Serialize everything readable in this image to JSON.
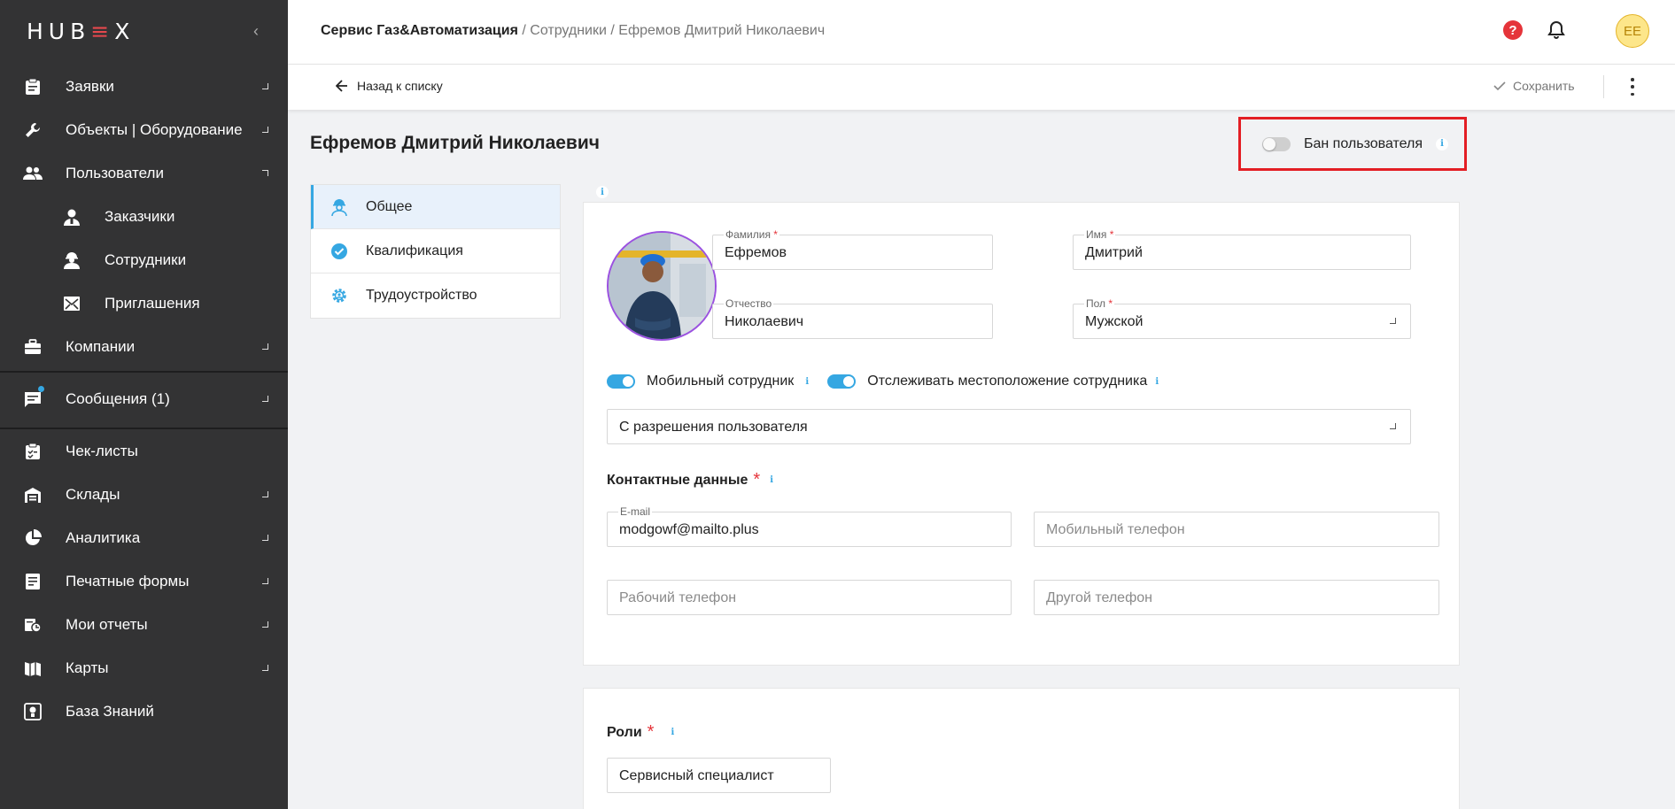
{
  "app": {
    "logo_text_a": "HUB",
    "logo_text_b": "≡",
    "logo_text_c": "X"
  },
  "sidebar": {
    "items": [
      {
        "label": "Заявки",
        "icon": "clipboard-icon",
        "expandable": true
      },
      {
        "label": "Объекты | Оборудование",
        "icon": "wrench-icon",
        "expandable": true
      },
      {
        "label": "Пользователи",
        "icon": "users-icon",
        "expandable": true,
        "expanded": true
      },
      {
        "label": "Заказчики",
        "icon": "customer-icon",
        "sub": true
      },
      {
        "label": "Сотрудники",
        "icon": "worker-icon",
        "sub": true
      },
      {
        "label": "Приглашения",
        "icon": "invite-icon",
        "sub": true
      },
      {
        "label": "Компании",
        "icon": "briefcase-icon",
        "expandable": true
      },
      {
        "label": "Сообщения (1)",
        "icon": "message-icon",
        "expandable": true
      },
      {
        "label": "Чек-листы",
        "icon": "checklist-icon"
      },
      {
        "label": "Склады",
        "icon": "warehouse-icon",
        "expandable": true
      },
      {
        "label": "Аналитика",
        "icon": "pie-chart-icon",
        "expandable": true
      },
      {
        "label": "Печатные формы",
        "icon": "print-form-icon",
        "expandable": true
      },
      {
        "label": "Мои отчеты",
        "icon": "reports-icon",
        "expandable": true
      },
      {
        "label": "Карты",
        "icon": "map-icon",
        "expandable": true
      },
      {
        "label": "База Знаний",
        "icon": "knowledge-icon"
      }
    ]
  },
  "header": {
    "breadcrumb_root": "Сервис Газ&Автоматизация",
    "breadcrumb_sep": " / ",
    "breadcrumb_mid": "Сотрудники",
    "breadcrumb_current": "Ефремов Дмитрий Николаевич",
    "avatar_initials": "EE"
  },
  "toolbar": {
    "back_label": "Назад к списку",
    "save_label": "Сохранить"
  },
  "page": {
    "title": "Ефремов Дмитрий Николаевич",
    "ban_label": "Бан пользователя"
  },
  "tabs": [
    {
      "label": "Общее",
      "active": true
    },
    {
      "label": "Квалификация"
    },
    {
      "label": "Трудоустройство"
    }
  ],
  "form": {
    "last_name": {
      "label": "Фамилия",
      "value": "Ефремов"
    },
    "first_name": {
      "label": "Имя",
      "value": "Дмитрий"
    },
    "patronymic": {
      "label": "Отчество",
      "value": "Николаевич"
    },
    "gender": {
      "label": "Пол",
      "value": "Мужской"
    },
    "mobile_employee_label": "Мобильный сотрудник",
    "track_location_label": "Отслеживать местоположение сотрудника",
    "location_mode": "С разрешения пользователя",
    "contacts_title": "Контактные данные",
    "email": {
      "label": "E-mail",
      "value": "modgowf@mailto.plus"
    },
    "mobile_phone_placeholder": "Мобильный телефон",
    "work_phone_placeholder": "Рабочий телефон",
    "other_phone_placeholder": "Другой телефон",
    "roles_title": "Роли",
    "role_value": "Сервисный специалист",
    "required_mark": "*"
  },
  "colors": {
    "accent": "#35a7e2",
    "sidebar_bg": "#333334",
    "danger": "#e31e24"
  }
}
